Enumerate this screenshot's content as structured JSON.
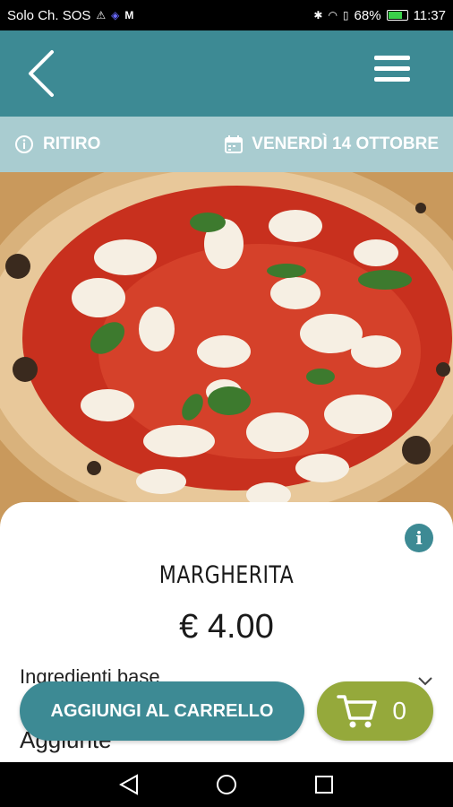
{
  "status_bar": {
    "carrier": "Solo Ch. SOS",
    "battery_percent": "68%",
    "battery_level": 0.68,
    "time": "11:37"
  },
  "info_bar": {
    "mode": "RITIRO",
    "date": "VENERDÌ 14 OTTOBRE"
  },
  "product": {
    "name": "MARGHERITA",
    "price": "€ 4.00"
  },
  "sections": {
    "base_ingredients": "Ingredienti base",
    "additions": "Aggiunte"
  },
  "actions": {
    "add_to_cart": "AGGIUNGI AL CARRELLO",
    "cart_count": "0"
  },
  "colors": {
    "primary": "#3d8a94",
    "info_bar": "#a9ccd0",
    "cart_button": "#95a93b"
  },
  "icons": [
    "back-arrow-icon",
    "hamburger-menu-icon",
    "info-circle-icon",
    "calendar-icon",
    "chevron-down-icon",
    "cart-icon"
  ]
}
